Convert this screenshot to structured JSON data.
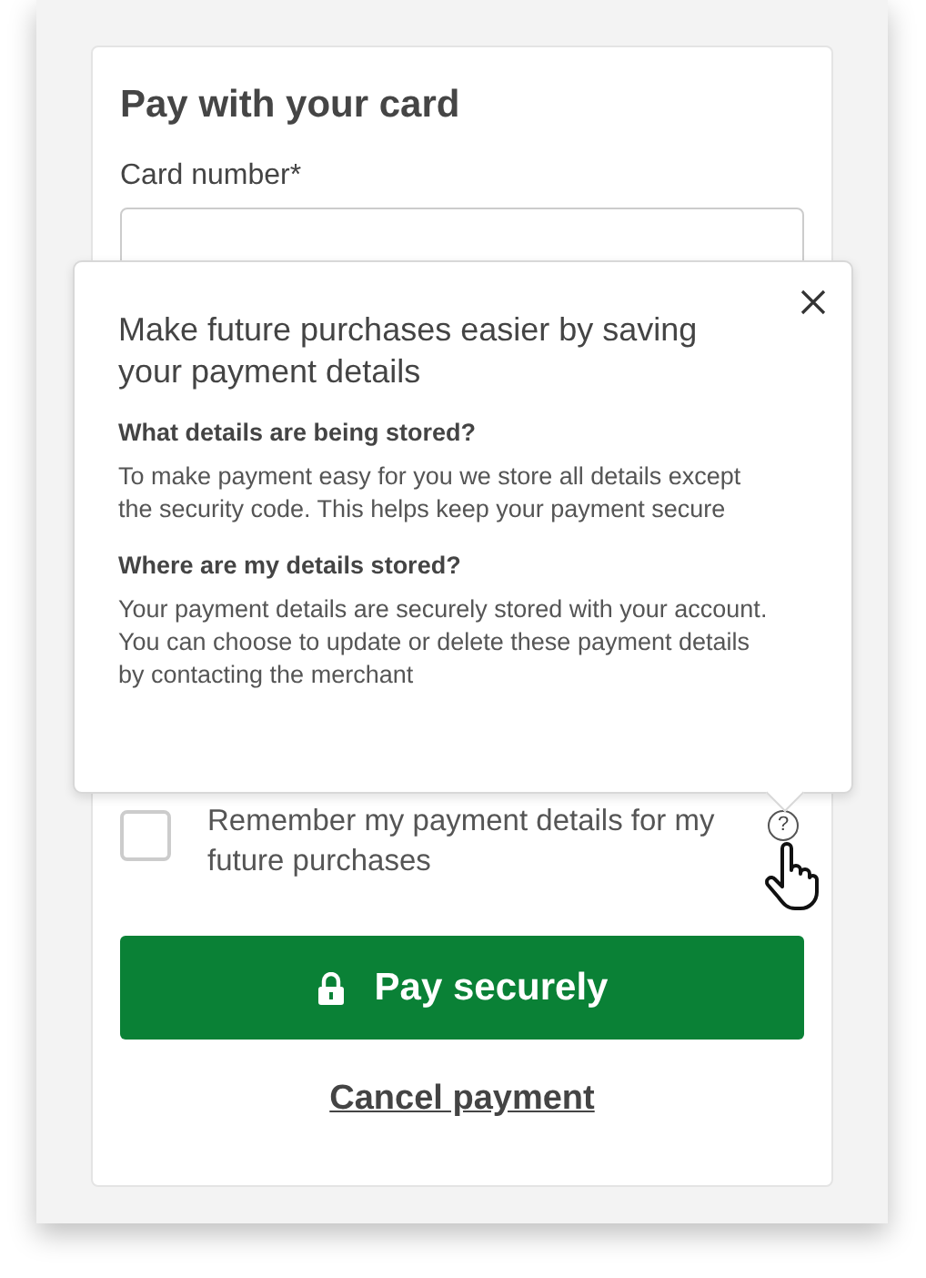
{
  "card": {
    "title": "Pay with your card",
    "card_number_label": "Card number*"
  },
  "popover": {
    "title": "Make future purchases easier by saving your payment details",
    "sections": [
      {
        "heading": "What details are being stored?",
        "text": "To make payment easy for you we store all details except the security code. This helps keep your payment secure"
      },
      {
        "heading": "Where are my details stored?",
        "text": "Your payment details are securely stored with your account. You can choose to update or delete these payment details by contacting the merchant"
      }
    ]
  },
  "remember": {
    "label": "Remember my payment details for my future purchases",
    "checked": false,
    "help": "?"
  },
  "pay_button": "Pay securely",
  "cancel_link": "Cancel payment"
}
